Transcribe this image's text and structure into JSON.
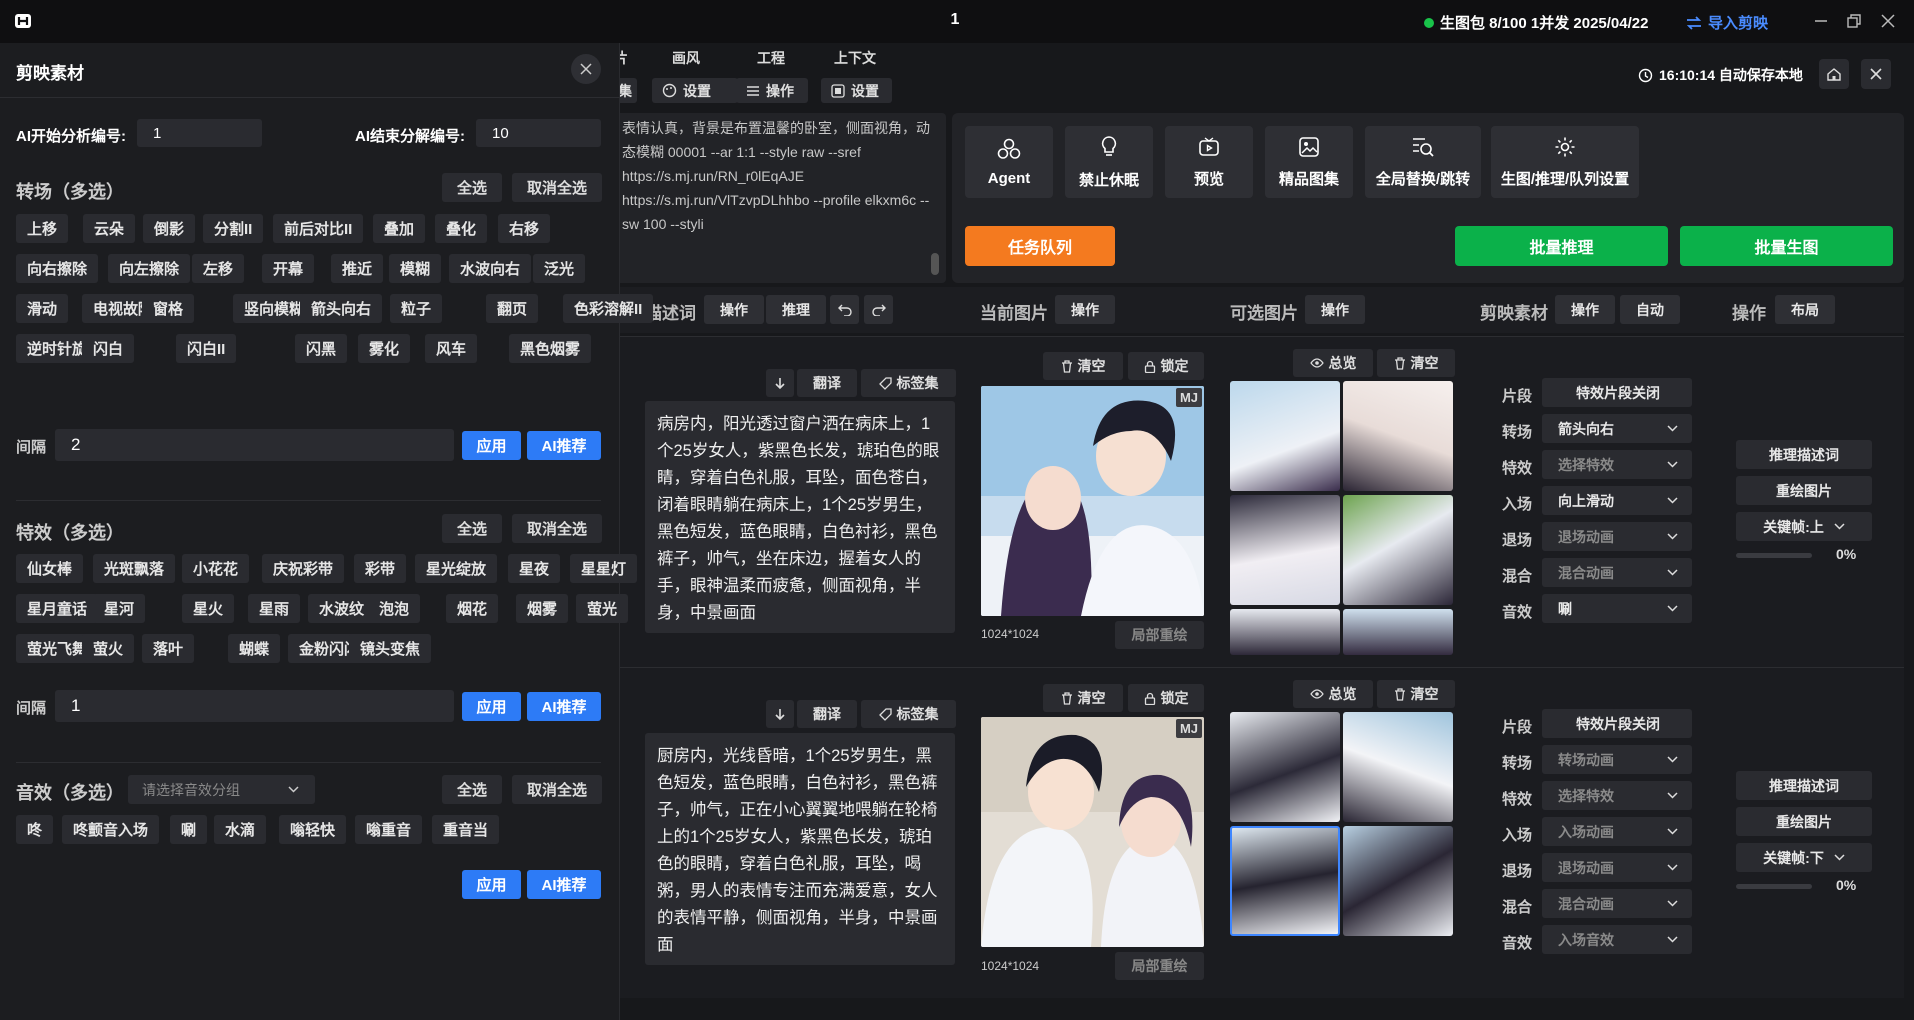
{
  "titlebar": {
    "center": "1",
    "status": "生图包 8/100 1并发 2025/04/22",
    "import": "导入剪映"
  },
  "tabs": [
    "片",
    "画风",
    "工程",
    "上下文"
  ],
  "toolbar": {
    "b0": "集",
    "b1": "设置",
    "b2": "操作",
    "b3": "设置"
  },
  "autosave": "16:10:14 自动保存本地",
  "prompt_text": "表情认真，背景是布置温馨的卧室，侧面视角，动态模糊 00001 --ar 1:1 --style raw --sref https://s.mj.run/RN_r0lEqAJE https://s.mj.run/VlTzvpDLhhbo --profile elkxm6c --sw 100 --styli",
  "tools": [
    "Agent",
    "禁止休眠",
    "预览",
    "精品图集",
    "全局替换/跳转",
    "生图/推理/队列设置"
  ],
  "task_queue": "任务队列",
  "batch_infer": "批量推理",
  "batch_gen": "批量生图",
  "columns": {
    "desc": "描述词",
    "op": "操作",
    "infer": "推理",
    "current": "当前图片",
    "optional": "可选图片",
    "jianying": "剪映素材",
    "auto": "自动",
    "operation": "操作",
    "layout": "布局"
  },
  "row_actions": {
    "translate": "翻译",
    "tags": "标签集",
    "clear": "清空",
    "lock": "锁定",
    "overview": "总览",
    "redraw_local": "局部重绘",
    "infer_desc": "推理描述词",
    "redraw": "重绘图片"
  },
  "field_labels": [
    "片段",
    "转场",
    "特效",
    "入场",
    "退场",
    "混合",
    "音效"
  ],
  "rows": [
    {
      "desc": "病房内，阳光透过窗户洒在病床上，1个25岁女人，紫黑色长发，琥珀色的眼睛，穿着白色礼服，耳坠，面色苍白，闭着眼睛躺在病床上，1个25岁男生，黑色短发，蓝色眼睛，白色衬衫，黑色裤子，帅气，坐在床边，握着女人的手，眼神温柔而疲惫，侧面视角，半身，中景画面",
      "badge": "MJ",
      "res": "1024*1024",
      "fields": [
        "特效片段关闭",
        "箭头向右",
        "选择特效",
        "向上滑动",
        "退场动画",
        "混合动画",
        "唰"
      ],
      "keyframe": "关键帧:上",
      "progress": "0%",
      "progress_value": 0
    },
    {
      "desc": "厨房内，光线昏暗，1个25岁男生，黑色短发，蓝色眼睛，白色衬衫，黑色裤子，帅气，正在小心翼翼地喂躺在轮椅上的1个25岁女人，紫黑色长发，琥珀色的眼睛，穿着白色礼服，耳坠，喝粥，男人的表情专注而充满爱意，女人的表情平静，侧面视角，半身，中景画面",
      "badge": "MJ",
      "res": "1024*1024",
      "fields": [
        "特效片段关闭",
        "转场动画",
        "选择特效",
        "入场动画",
        "退场动画",
        "混合动画",
        "入场音效"
      ],
      "keyframe": "关键帧:下",
      "progress": "0%",
      "progress_value": 0
    }
  ],
  "panel": {
    "title": "剪映素材",
    "ai_start_label": "AI开始分析编号:",
    "ai_start": "1",
    "ai_end_label": "AI结束分解编号:",
    "ai_end": "10",
    "select_all": "全选",
    "deselect_all": "取消全选",
    "interval": "间隔",
    "apply": "应用",
    "ai_rec": "AI推荐",
    "transition_title": "转场（多选）",
    "transitions": [
      "上移",
      "云朵",
      "倒影",
      "分割II",
      "前后对比II",
      "叠加",
      "叠化",
      "右移",
      "向右擦除",
      "向左擦除",
      "左移",
      "开幕",
      "推近",
      "模糊",
      "水波向右",
      "泛光",
      "滑动",
      "电视故障I",
      "窗格",
      "竖向模糊",
      "箭头向右",
      "粒子",
      "翻页",
      "色彩溶解II",
      "逆时针旋转II",
      "闪白",
      "闪白II",
      "闪黑",
      "雾化",
      "风车",
      "黑色烟雾"
    ],
    "transition_interval": "2",
    "effect_title": "特效（多选）",
    "effects": [
      "仙女棒",
      "光斑飘落",
      "小花花",
      "庆祝彩带",
      "彩带",
      "星光绽放",
      "星夜",
      "星星灯",
      "星月童话",
      "星河",
      "星火",
      "星雨",
      "水波纹",
      "泡泡",
      "烟花",
      "烟雾",
      "萤光",
      "萤光飞舞",
      "萤火",
      "落叶",
      "蝴蝶",
      "金粉闪闪",
      "镜头变焦"
    ],
    "effect_interval": "1",
    "sound_title": "音效（多选）",
    "sound_group_placeholder": "请选择音效分组",
    "sounds": [
      "咚",
      "咚颤音入场",
      "唰",
      "水滴",
      "嗡轻快",
      "嗡重音",
      "重音当"
    ]
  }
}
